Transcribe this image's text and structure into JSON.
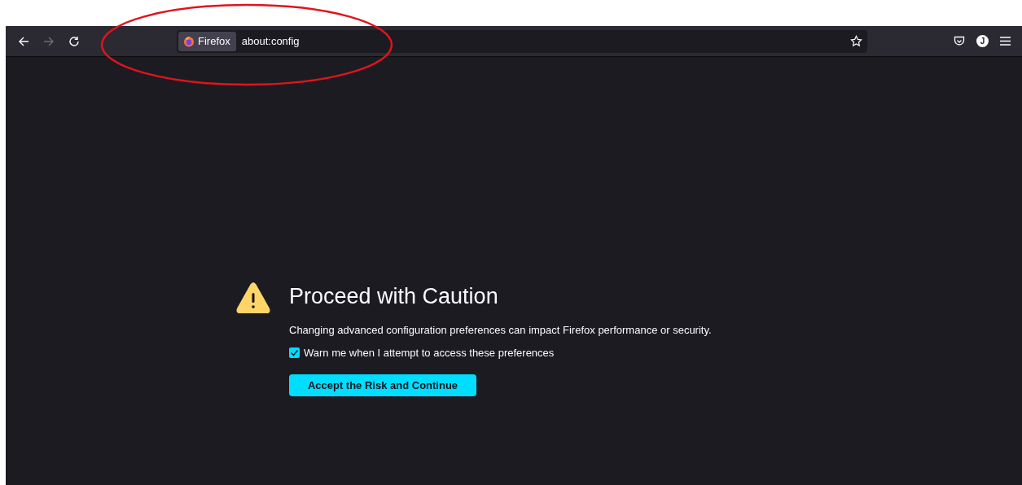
{
  "toolbar": {
    "back": {
      "disabled": false
    },
    "forward": {
      "disabled": true
    },
    "identity_label": "Firefox",
    "url": "about:config",
    "avatar_letter": "J"
  },
  "warning": {
    "title": "Proceed with Caution",
    "message": "Changing advanced configuration preferences can impact Firefox performance or security.",
    "checkbox": {
      "label": "Warn me when I attempt to access these preferences",
      "checked": true
    },
    "button": "Accept the Risk and Continue"
  }
}
